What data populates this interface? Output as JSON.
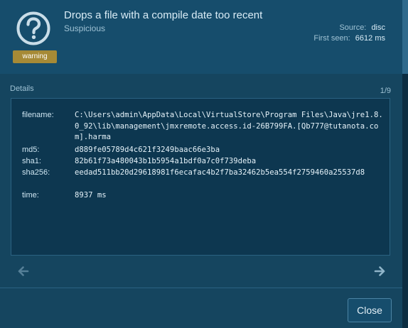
{
  "header": {
    "title": "Drops a file with a compile date too recent",
    "subtitle": "Suspicious",
    "badge": "warning",
    "icon": "question-circle-icon",
    "source_label": "Source:",
    "source_value": "disc",
    "first_seen_label": "First seen:",
    "first_seen_value": "6612 ms"
  },
  "details": {
    "label": "Details",
    "pager": "1/9",
    "fields": {
      "filename_key": "filename:",
      "filename_value": "C:\\Users\\admin\\AppData\\Local\\VirtualStore\\Program Files\\Java\\jre1.8.0_92\\lib\\management\\jmxremote.access.id-26B799FA.[Qb777@tutanota.com].harma",
      "md5_key": "md5:",
      "md5_value": "d889fe05789d4c621f3249baac66e3ba",
      "sha1_key": "sha1:",
      "sha1_value": "82b61f73a480043b1b5954a1bdf0a7c0f739deba",
      "sha256_key": "sha256:",
      "sha256_value": "eedad511bb20d29618981f6ecafac4b2f7ba32462b5ea554f2759460a25537d8",
      "time_key": "time:",
      "time_value": "8937 ms"
    }
  },
  "nav": {
    "prev_icon": "arrow-left-icon",
    "next_icon": "arrow-right-icon"
  },
  "footer": {
    "close_label": "Close"
  },
  "colors": {
    "background": "#15455f",
    "header": "#164d6c",
    "panel": "#0d3750",
    "badge": "#a68a36",
    "border": "#2b6282"
  }
}
